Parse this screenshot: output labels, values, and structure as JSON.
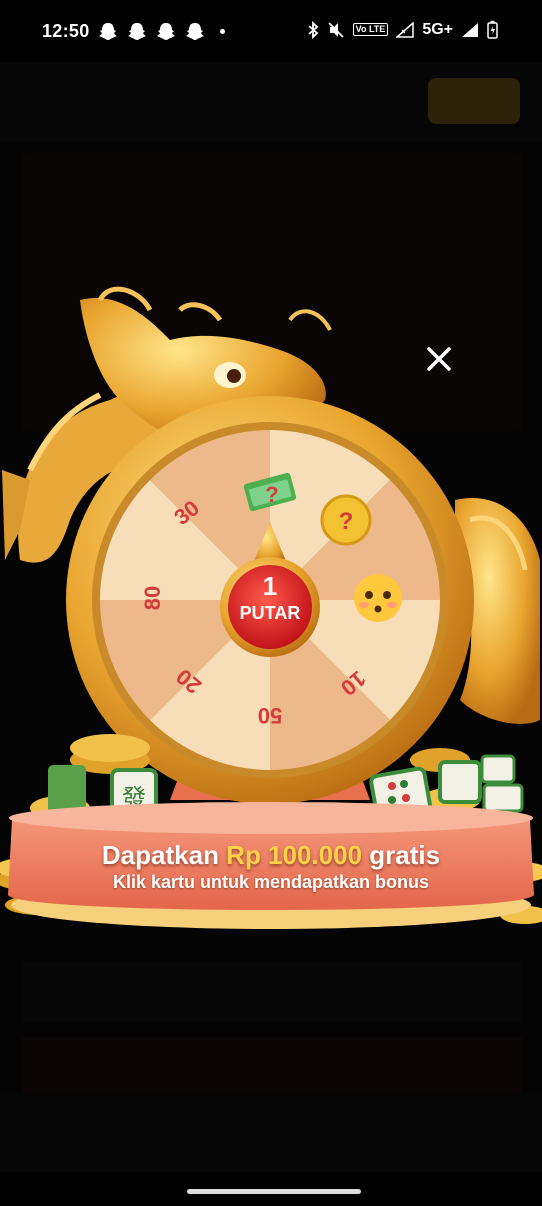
{
  "status_bar": {
    "time": "12:50",
    "network": "5G+",
    "volte": "Vo LTE",
    "icons": [
      "snapchat-icon",
      "snapchat-icon",
      "snapchat-icon",
      "snapchat-icon",
      "bluetooth-icon",
      "mute-icon",
      "signal-icon",
      "battery-icon"
    ]
  },
  "popup": {
    "banner": {
      "prefix": "Dapatkan ",
      "amount": "Rp 100.000",
      "suffix": " gratis",
      "subtitle": "Klik kartu untuk mendapatkan bonus"
    },
    "spin_button": {
      "count": "1",
      "label": "PUTAR"
    },
    "wheel_segments": [
      {
        "label": "30"
      },
      {
        "label": "80"
      },
      {
        "label": "20"
      },
      {
        "label": "50"
      },
      {
        "label": "10"
      }
    ]
  },
  "colors": {
    "gold": "#f2b53a",
    "segment_light": "#f7ddb8",
    "segment_dark": "#eeb98a",
    "spin_red": "#e0282a",
    "highlight": "#ffd24a",
    "platform": "#ef7f63"
  }
}
